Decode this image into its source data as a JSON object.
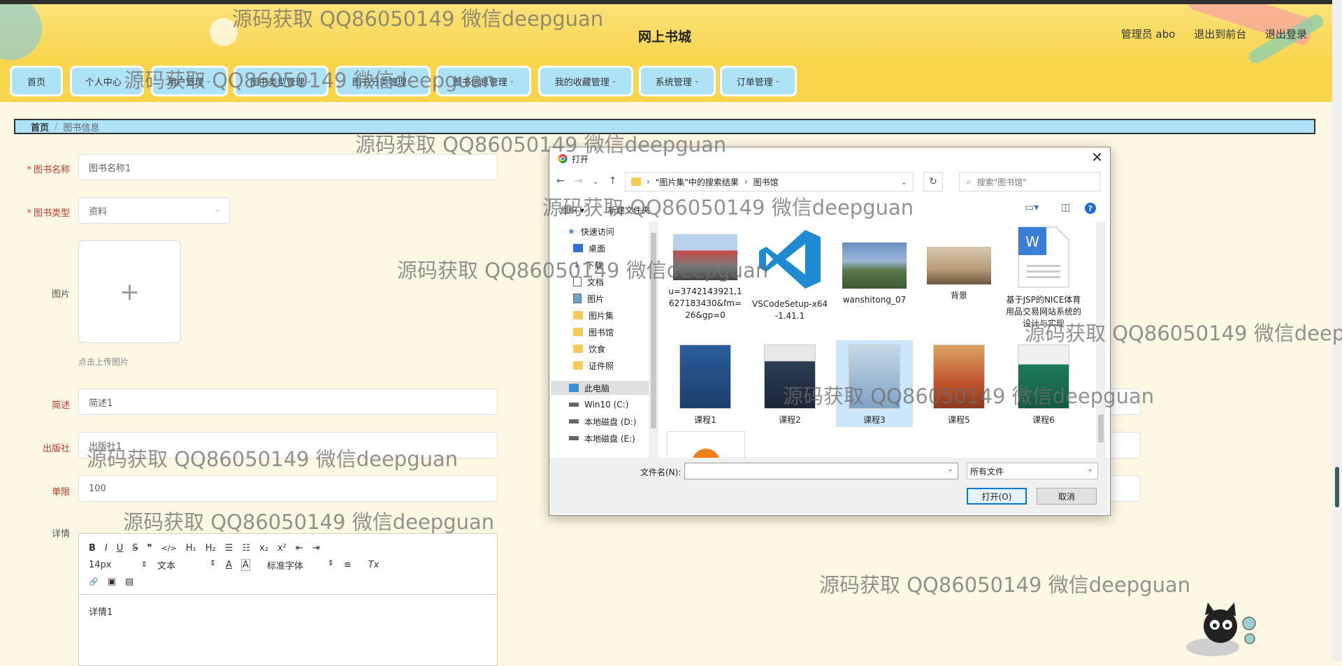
{
  "header": {
    "site_title": "网上书城",
    "user_label": "管理员 abo",
    "back_link": "退出到前台",
    "logout_link": "退出登录"
  },
  "nav": {
    "items": [
      {
        "label": "首页",
        "dropdown": false
      },
      {
        "label": "个人中心",
        "dropdown": true
      },
      {
        "label": "用户管理",
        "dropdown": true
      },
      {
        "label": "图书类型管理",
        "dropdown": true
      },
      {
        "label": "图书分类管理",
        "dropdown": true
      },
      {
        "label": "图书信息管理",
        "dropdown": true
      },
      {
        "label": "我的收藏管理",
        "dropdown": true
      },
      {
        "label": "系统管理",
        "dropdown": true
      },
      {
        "label": "订单管理",
        "dropdown": true
      }
    ],
    "chevron": "⌄"
  },
  "breadcrumb": {
    "home": "首页",
    "separator": "/",
    "current": "图书信息"
  },
  "form": {
    "book_name_label": "图书名称",
    "book_name_value": "图书名称1",
    "book_type_label": "图书类型",
    "book_type_value": "资料",
    "image_label": "图片",
    "upload_plus": "+",
    "upload_hint": "点击上传图片",
    "summary_label": "简述",
    "summary_value": "简述1",
    "publisher_label": "出版社",
    "publisher_value": "出版社1",
    "limit_label": "单限",
    "limit_value": "100",
    "details_label": "详情",
    "required_mark": "*"
  },
  "editor": {
    "font_size": "14px",
    "format": "文本",
    "font_family": "标准字体",
    "content": "详情1",
    "toolbar_row1": [
      "B",
      "I",
      "U",
      "S",
      "❞",
      "</>",
      "H₁",
      "H₂",
      "☰",
      "☷",
      "x₂",
      "x²",
      "⇤",
      "⇥"
    ],
    "toolbar_row3": [
      "🔗",
      "▣",
      "▤"
    ],
    "color_a": "A",
    "bg_a": "A",
    "align": "≡",
    "clear": "Tx",
    "select_caret": "⇕"
  },
  "dialog": {
    "title": "打开",
    "close": "✕",
    "nav_back": "←",
    "nav_forward": "→",
    "nav_down": "⌄",
    "nav_up": "↑",
    "breadcrumb_part1": "\"图片集\"中的搜索结果",
    "breadcrumb_sep": "›",
    "breadcrumb_part2": "图书馆",
    "refresh": "↻",
    "search_placeholder": "搜索\"图书馆\"",
    "toolbar_organize": "组织 ▾",
    "toolbar_new_folder": "新建文件夹",
    "help": "?",
    "sidebar": [
      {
        "label": "快速访问",
        "icon": "star-icon"
      },
      {
        "label": "桌面",
        "icon": "desktop-icon"
      },
      {
        "label": "下载",
        "icon": "download-icon"
      },
      {
        "label": "文档",
        "icon": "document-icon"
      },
      {
        "label": "图片",
        "icon": "picture-icon"
      },
      {
        "label": "图片集",
        "icon": "folder-icon"
      },
      {
        "label": "图书馆",
        "icon": "folder-icon"
      },
      {
        "label": "饮食",
        "icon": "folder-icon"
      },
      {
        "label": "证件照",
        "icon": "folder-icon"
      },
      {
        "label": "此电脑",
        "icon": "computer-icon"
      },
      {
        "label": "Win10 (C:)",
        "icon": "drive-icon"
      },
      {
        "label": "本地磁盘 (D:)",
        "icon": "drive-icon"
      },
      {
        "label": "本地磁盘 (E:)",
        "icon": "drive-icon"
      }
    ],
    "files": [
      {
        "name": "u=3742143921,1627183430&fm=26&gp=0"
      },
      {
        "name": "VSCodeSetup-x64-1.41.1"
      },
      {
        "name": "wanshitong_07"
      },
      {
        "name": "背景"
      },
      {
        "name": "基于JSP的NICE体育用品交易网站系统的设计与实现"
      },
      {
        "name": "课程1"
      },
      {
        "name": "课程2"
      },
      {
        "name": "课程3",
        "selected": true
      },
      {
        "name": "课程5"
      },
      {
        "name": "课程6"
      }
    ],
    "filename_label": "文件名(N):",
    "filetype_value": "所有文件",
    "open_button": "打开(O)",
    "cancel_button": "取消"
  },
  "watermark": "源码获取 QQ86050149 微信deepguan",
  "colors": {
    "nav_bg": "#f8d54c",
    "nav_item": "#aee3f7",
    "page_bg": "#fdf8e4",
    "selected_file": "#cce6fb",
    "primary_button_border": "#0078d7"
  }
}
